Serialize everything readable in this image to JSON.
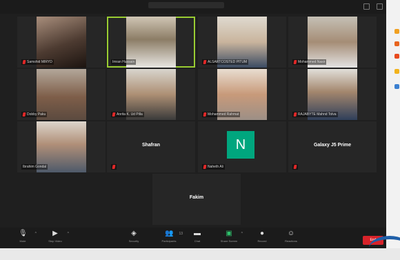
{
  "participants": [
    {
      "name": "Samshid MIRYD",
      "avatar": "photo-1"
    },
    {
      "name": "Imran Hussain",
      "avatar": "photo-2",
      "active_speaker": true
    },
    {
      "name": "ALSARTCOSTED PITUM",
      "avatar": "photo-3"
    },
    {
      "name": "Mohammed Nasir",
      "avatar": "photo-4"
    },
    {
      "name": "Dobby Paku",
      "avatar": "photo-5"
    },
    {
      "name": "Anrita K. Ud Pilla",
      "avatar": "photo-6"
    },
    {
      "name": "Mohammed Rahmat",
      "avatar": "photo-7"
    },
    {
      "name": "RAJABYTE Mahnd Tolva",
      "avatar": "photo-8"
    },
    {
      "name": "Ibrahim Gondal",
      "avatar": "photo-9"
    },
    {
      "name": "Shafran",
      "avatar": "name-only"
    },
    {
      "name": "Naheth Ali",
      "avatar": "initial",
      "initial": "N"
    },
    {
      "name": "Galaxy J5 Prime",
      "avatar": "name-only"
    },
    {
      "name": "Fakim",
      "avatar": "name-only"
    }
  ],
  "toolbar": {
    "mute": "Mute",
    "video": "Stop Video",
    "security": "Security",
    "participants": "Participants",
    "participants_count": "13",
    "chat": "Chat",
    "share": "Share Screen",
    "record": "Record",
    "reactions": "Reactions",
    "end": "End"
  },
  "colors": {
    "speaker_border": "#9acd32",
    "avatar_bg": "#00a67e",
    "end_button": "#d8232a",
    "mute_icon": "#e02828"
  }
}
